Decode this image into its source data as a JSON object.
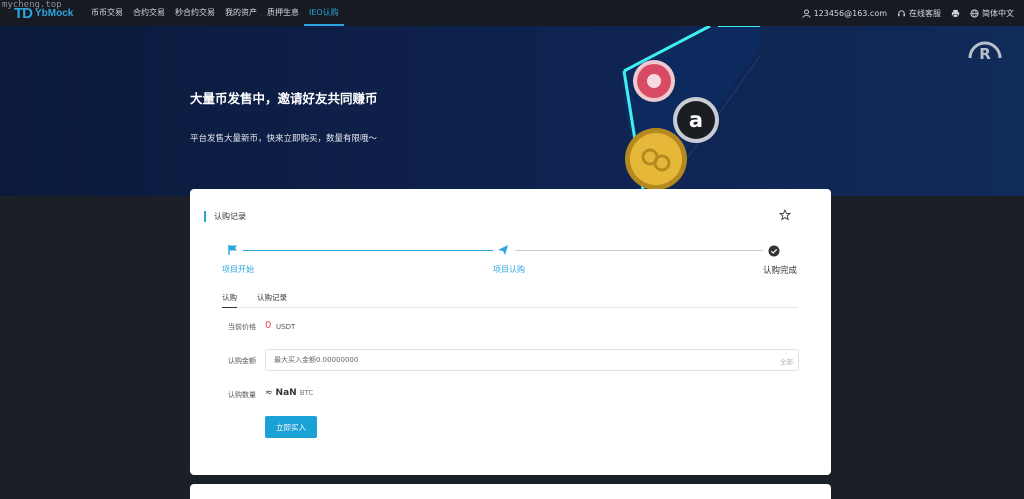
{
  "watermark": "mycheng.top",
  "brand": {
    "mark": "TD",
    "name": "YbMock"
  },
  "nav": [
    "币币交易",
    "合约交易",
    "秒合约交易",
    "我的资产",
    "质押生息",
    "IEO认购"
  ],
  "nav_active_index": 5,
  "user": {
    "email": "123456@163.com",
    "support": "在线客服",
    "language": "简体中文"
  },
  "banner": {
    "title": "大量币发售中，邀请好友共同赚币",
    "subtitle": "平台发售大量新币，快来立即购买，数量有限哦～"
  },
  "card": {
    "title": "认购记录",
    "steps": [
      "项目开始",
      "项目认购",
      "认购完成"
    ],
    "tabs": [
      "认购",
      "认购记录"
    ],
    "price_label": "当前价格",
    "price_value": "0",
    "price_unit": "USDT",
    "amount_label": "认购金额",
    "amount_placeholder": "最大买入金额0.00000000",
    "all_label": "全部",
    "qty_label": "认购数量",
    "qty_prefix": "≈",
    "qty_value": "NaN",
    "qty_unit": "BTC",
    "buy_label": "立即买入"
  },
  "colors": {
    "accent": "#2aa5e0",
    "price": "#e24a4a",
    "button": "#1aa1d6"
  }
}
